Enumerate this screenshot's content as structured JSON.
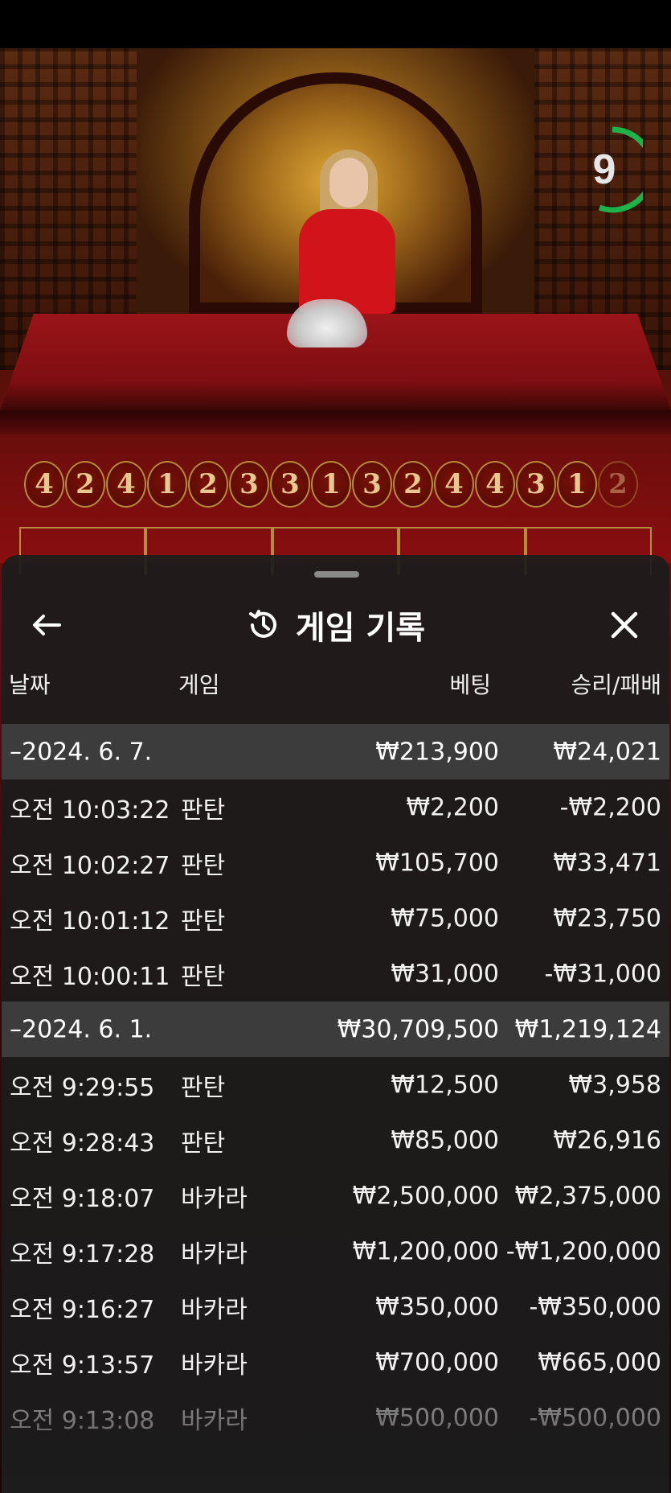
{
  "game": {
    "timer": "9",
    "road": [
      "4",
      "2",
      "4",
      "1",
      "2",
      "3",
      "3",
      "1",
      "3",
      "2",
      "4",
      "4",
      "3",
      "1",
      "2"
    ],
    "bet_areas": [
      "",
      "",
      "",
      "",
      ""
    ]
  },
  "sheet": {
    "title": "게임 기록",
    "icons": {
      "back": "arrow-left-icon",
      "history": "history-icon",
      "close": "close-icon"
    },
    "columns": {
      "date": "날짜",
      "game": "게임",
      "bet": "베팅",
      "win": "승리/패배"
    },
    "groups": [
      {
        "date": "–2024. 6. 7.",
        "bet": "₩213,900",
        "win": "₩24,021",
        "rows": [
          {
            "time": "오전 10:03:22",
            "game": "판탄",
            "bet": "₩2,200",
            "win": "-₩2,200"
          },
          {
            "time": "오전 10:02:27",
            "game": "판탄",
            "bet": "₩105,700",
            "win": "₩33,471"
          },
          {
            "time": "오전 10:01:12",
            "game": "판탄",
            "bet": "₩75,000",
            "win": "₩23,750"
          },
          {
            "time": "오전 10:00:11",
            "game": "판탄",
            "bet": "₩31,000",
            "win": "-₩31,000"
          }
        ]
      },
      {
        "date": "–2024. 6. 1.",
        "bet": "₩30,709,500",
        "win": "₩1,219,124",
        "rows": [
          {
            "time": "오전 9:29:55",
            "game": "판탄",
            "bet": "₩12,500",
            "win": "₩3,958"
          },
          {
            "time": "오전 9:28:43",
            "game": "판탄",
            "bet": "₩85,000",
            "win": "₩26,916"
          },
          {
            "time": "오전 9:18:07",
            "game": "바카라",
            "bet": "₩2,500,000",
            "win": "₩2,375,000"
          },
          {
            "time": "오전 9:17:28",
            "game": "바카라",
            "bet": "₩1,200,000",
            "win": "-₩1,200,000"
          },
          {
            "time": "오전 9:16:27",
            "game": "바카라",
            "bet": "₩350,000",
            "win": "-₩350,000"
          },
          {
            "time": "오전 9:13:57",
            "game": "바카라",
            "bet": "₩700,000",
            "win": "₩665,000"
          },
          {
            "time": "오전 9:13:08",
            "game": "바카라",
            "bet": "₩500,000",
            "win": "-₩500,000"
          }
        ]
      }
    ]
  }
}
